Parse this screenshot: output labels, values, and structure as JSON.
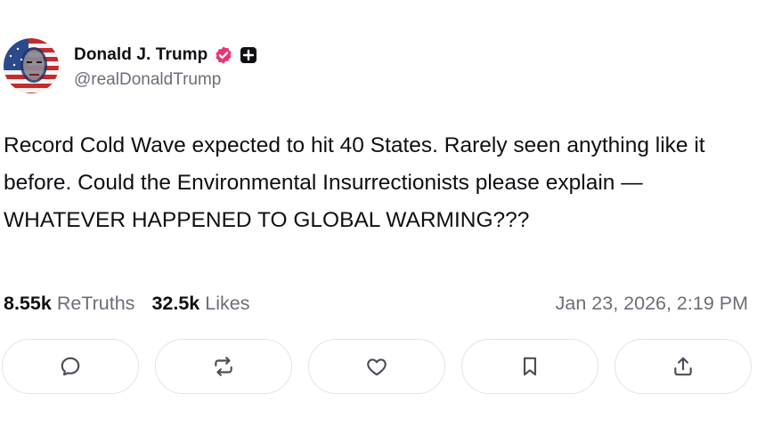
{
  "author": {
    "display_name": "Donald J. Trump",
    "handle": "@realDonaldTrump",
    "verified_badge_color": "#e8366f",
    "plus_badge_color": "#0f0f14"
  },
  "post": {
    "text": "Record Cold Wave expected to hit 40 States. Rarely seen anything like it before. Could the Environmental Insurrectionists please explain — WHATEVER HAPPENED TO GLOBAL WARMING???"
  },
  "stats": {
    "retruths_count": "8.55k",
    "retruths_label": "ReTruths",
    "likes_count": "32.5k",
    "likes_label": "Likes",
    "timestamp": "Jan 23, 2026, 2:19 PM"
  },
  "actions": [
    {
      "icon": "reply-icon"
    },
    {
      "icon": "retruth-icon"
    },
    {
      "icon": "like-icon"
    },
    {
      "icon": "bookmark-icon"
    },
    {
      "icon": "share-icon"
    }
  ]
}
